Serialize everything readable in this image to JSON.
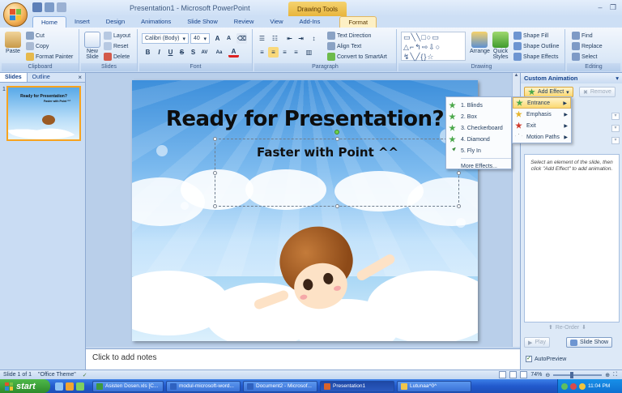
{
  "window": {
    "title": "Presentation1 - Microsoft PowerPoint",
    "context_tab": "Drawing Tools"
  },
  "ribbon_tabs": [
    "Home",
    "Insert",
    "Design",
    "Animations",
    "Slide Show",
    "Review",
    "View",
    "Add-Ins",
    "Format"
  ],
  "clipboard": {
    "paste": "Paste",
    "cut": "Cut",
    "copy": "Copy",
    "format_painter": "Format Painter",
    "label": "Clipboard"
  },
  "slides_group": {
    "new_slide": "New Slide",
    "layout": "Layout",
    "reset": "Reset",
    "delete": "Delete",
    "label": "Slides"
  },
  "font": {
    "name": "Calibri (Body)",
    "size": "40",
    "label": "Font"
  },
  "paragraph": {
    "text_direction": "Text Direction",
    "align_text": "Align Text",
    "convert_smartart": "Convert to SmartArt",
    "label": "Paragraph"
  },
  "drawing": {
    "arrange": "Arrange",
    "quick_styles": "Quick Styles",
    "shape_fill": "Shape Fill",
    "shape_outline": "Shape Outline",
    "shape_effects": "Shape Effects",
    "label": "Drawing"
  },
  "editing": {
    "find": "Find",
    "replace": "Replace",
    "select": "Select",
    "label": "Editing"
  },
  "left_pane": {
    "tabs": [
      "Slides",
      "Outline"
    ],
    "slide_number": "1",
    "thumb_title": "Ready for Presentation?",
    "thumb_sub": "Faster with Point ^^"
  },
  "slide": {
    "title": "Ready for Presentation?",
    "subtitle": "Faster with Point ^^"
  },
  "notes_placeholder": "Click to add notes",
  "effects_menu": {
    "items": [
      "1. Blinds",
      "2. Box",
      "3. Checkerboard",
      "4. Diamond",
      "5. Fly In"
    ],
    "more": "More Effects..."
  },
  "add_effect_submenu": [
    "Entrance",
    "Emphasis",
    "Exit",
    "Motion Paths"
  ],
  "task_pane": {
    "title": "Custom Animation",
    "add_effect": "Add Effect",
    "remove": "Remove",
    "hint": "Select an element of the slide, then click \"Add Effect\" to add animation.",
    "reorder": "Re-Order",
    "play": "Play",
    "slide_show": "Slide Show",
    "autopreview": "AutoPreview"
  },
  "status": {
    "slide_info": "Slide 1 of 1",
    "theme": "\"Office Theme\"",
    "zoom": "74%",
    "zoom_fraction": 0.37
  },
  "taskbar": {
    "start": "start",
    "buttons": [
      "Asisten Dosen.xls [C...",
      "modul-microsoft-word...",
      "Document2 - Microsof...",
      "Presentation1",
      "Lutunaa^0^"
    ],
    "active_index": 3,
    "clock": "11:04 PM"
  }
}
